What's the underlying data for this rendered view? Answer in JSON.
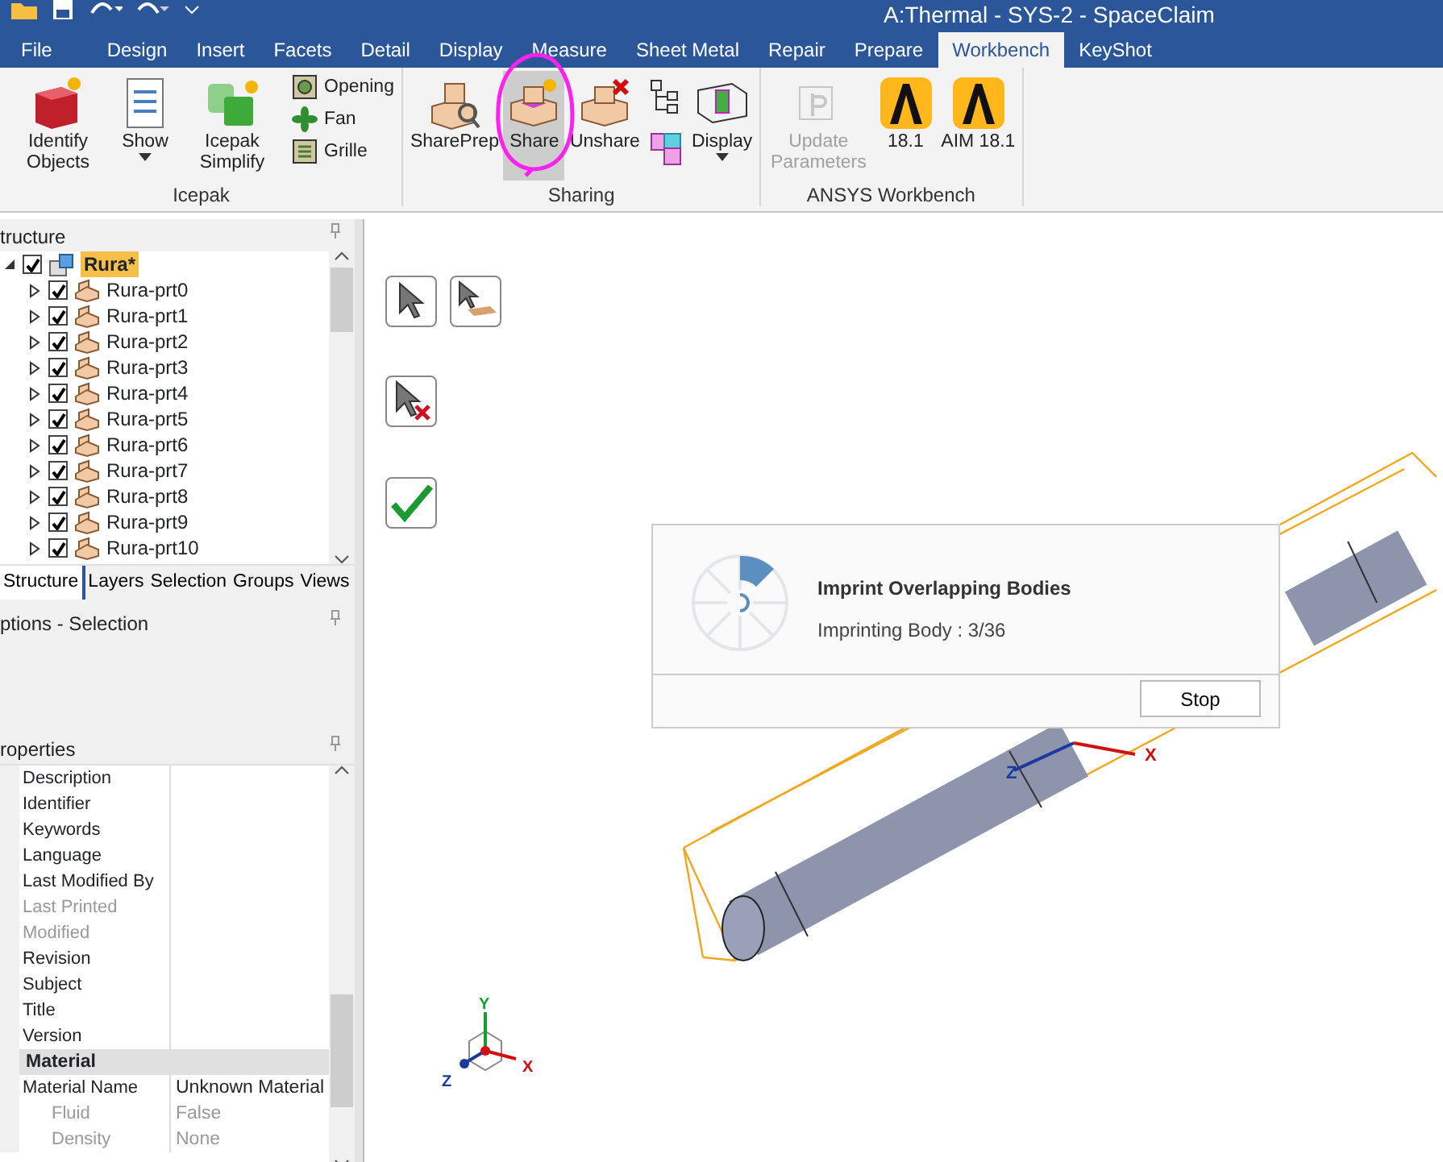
{
  "window": {
    "title": "A:Thermal - SYS-2 - SpaceClaim"
  },
  "ribbon_tabs": [
    {
      "label": "File",
      "selected": false
    },
    {
      "label": "Design",
      "selected": false
    },
    {
      "label": "Insert",
      "selected": false
    },
    {
      "label": "Facets",
      "selected": false
    },
    {
      "label": "Detail",
      "selected": false
    },
    {
      "label": "Display",
      "selected": false
    },
    {
      "label": "Measure",
      "selected": false
    },
    {
      "label": "Sheet Metal",
      "selected": false
    },
    {
      "label": "Repair",
      "selected": false
    },
    {
      "label": "Prepare",
      "selected": false
    },
    {
      "label": "Workbench",
      "selected": true
    },
    {
      "label": "KeyShot",
      "selected": false
    }
  ],
  "ribbon_groups": [
    {
      "label": "Icepak",
      "items": [
        {
          "kind": "large",
          "label": "Identify Objects",
          "selected": false,
          "disabled": false
        },
        {
          "kind": "large",
          "label": "Show",
          "dropdown": true,
          "selected": false,
          "disabled": false
        },
        {
          "kind": "large",
          "label": "Icepak Simplify",
          "selected": false,
          "disabled": false
        },
        {
          "kind": "small",
          "entries": [
            {
              "label": "Opening"
            },
            {
              "label": "Fan"
            },
            {
              "label": "Grille"
            }
          ]
        }
      ]
    },
    {
      "label": "Sharing",
      "items": [
        {
          "kind": "large",
          "label": "SharePrep",
          "selected": false,
          "disabled": false
        },
        {
          "kind": "large",
          "label": "Share",
          "selected": true,
          "disabled": false
        },
        {
          "kind": "large",
          "label": "Unshare",
          "selected": false,
          "disabled": false
        },
        {
          "kind": "iconstack"
        },
        {
          "kind": "large",
          "label": "Display",
          "dropdown": true,
          "selected": false,
          "disabled": false
        }
      ]
    },
    {
      "label": "ANSYS Workbench",
      "items": [
        {
          "kind": "large",
          "label": "Update Parameters",
          "selected": false,
          "disabled": true
        },
        {
          "kind": "large",
          "label": "18.1",
          "selected": false,
          "disabled": false
        },
        {
          "kind": "large",
          "label": "AIM 18.1",
          "selected": false,
          "disabled": false
        }
      ]
    }
  ],
  "structure_panel": {
    "title": "tructure",
    "tree": [
      {
        "label": "Rura*",
        "checked": true,
        "expanded": true,
        "selected": true,
        "children": [
          {
            "label": "Rura-prt0",
            "checked": true,
            "expanded": false,
            "selected": false
          },
          {
            "label": "Rura-prt1",
            "checked": true,
            "expanded": false,
            "selected": false
          },
          {
            "label": "Rura-prt2",
            "checked": true,
            "expanded": false,
            "selected": false
          },
          {
            "label": "Rura-prt3",
            "checked": true,
            "expanded": false,
            "selected": false
          },
          {
            "label": "Rura-prt4",
            "checked": true,
            "expanded": false,
            "selected": false
          },
          {
            "label": "Rura-prt5",
            "checked": true,
            "expanded": false,
            "selected": false
          },
          {
            "label": "Rura-prt6",
            "checked": true,
            "expanded": false,
            "selected": false
          },
          {
            "label": "Rura-prt7",
            "checked": true,
            "expanded": false,
            "selected": false
          },
          {
            "label": "Rura-prt8",
            "checked": true,
            "expanded": false,
            "selected": false
          },
          {
            "label": "Rura-prt9",
            "checked": true,
            "expanded": false,
            "selected": false
          },
          {
            "label": "Rura-prt10",
            "checked": true,
            "expanded": false,
            "selected": false
          }
        ]
      }
    ]
  },
  "panel_tabs": [
    {
      "label": "Structure",
      "selected": true
    },
    {
      "label": "Layers",
      "selected": false
    },
    {
      "label": "Selection",
      "selected": false
    },
    {
      "label": "Groups",
      "selected": false
    },
    {
      "label": "Views",
      "selected": false
    }
  ],
  "options_panel": {
    "title": "ptions - Selection"
  },
  "properties_panel": {
    "title": "roperties",
    "rows": [
      {
        "kind": "row",
        "name": "Description",
        "value": "",
        "disabled": false
      },
      {
        "kind": "row",
        "name": "Identifier",
        "value": "",
        "disabled": false
      },
      {
        "kind": "row",
        "name": "Keywords",
        "value": "",
        "disabled": false
      },
      {
        "kind": "row",
        "name": "Language",
        "value": "",
        "disabled": false
      },
      {
        "kind": "row",
        "name": "Last Modified By",
        "value": "",
        "disabled": false
      },
      {
        "kind": "row",
        "name": "Last Printed",
        "value": "",
        "disabled": true
      },
      {
        "kind": "row",
        "name": "Modified",
        "value": "",
        "disabled": true
      },
      {
        "kind": "row",
        "name": "Revision",
        "value": "",
        "disabled": false
      },
      {
        "kind": "row",
        "name": "Subject",
        "value": "",
        "disabled": false
      },
      {
        "kind": "row",
        "name": "Title",
        "value": "",
        "disabled": false
      },
      {
        "kind": "row",
        "name": "Version",
        "value": "",
        "disabled": false
      },
      {
        "kind": "category",
        "name": "Material"
      },
      {
        "kind": "row",
        "name": "Material Name",
        "value": "Unknown Material",
        "disabled": false,
        "children": [
          {
            "kind": "row",
            "name": "Fluid",
            "value": "False",
            "disabled": true
          },
          {
            "kind": "row",
            "name": "Density",
            "value": "None",
            "disabled": true
          }
        ]
      }
    ]
  },
  "progress_dialog": {
    "title": "Imprint Overlapping Bodies",
    "status": "Imprinting Body : 3/36",
    "button": "Stop"
  },
  "model_axes": [
    "Z",
    "X"
  ],
  "triad_axes": [
    "Y",
    "Z",
    "X"
  ]
}
